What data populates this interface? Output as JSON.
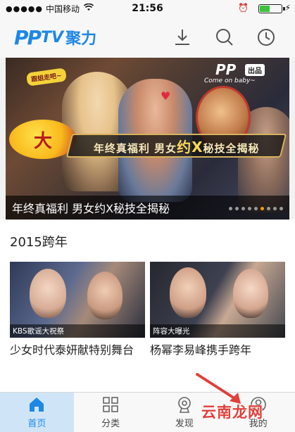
{
  "status_bar": {
    "signal": "●●●●●",
    "carrier": "中国移动",
    "time": "21:56"
  },
  "header": {
    "logo_pp": "PP",
    "logo_tv": "TV",
    "logo_name": "聚力"
  },
  "banner": {
    "caption": "年终真福利 男女约X秘技全揭秘",
    "overlay_text": "年终真福利 男女约X秘技全揭秘",
    "overlay_big": "约X",
    "show_name": "大",
    "bubble": "跟姐走吧~",
    "pp_logo": "PP",
    "pp_sub": "出品",
    "speech": "Come on baby~",
    "dots_total": 9,
    "dots_active_index": 5
  },
  "section": {
    "title": "2015跨年",
    "cards": [
      {
        "label": "KBS歌谣大祝祭",
        "title": "少女时代泰妍献特别舞台"
      },
      {
        "label": "阵容大曝光",
        "title": "杨幂李易峰携手跨年"
      }
    ]
  },
  "tabbar": {
    "tabs": [
      {
        "label": "首页",
        "icon": "home-icon",
        "active": true
      },
      {
        "label": "分类",
        "icon": "grid-icon",
        "active": false
      },
      {
        "label": "发现",
        "icon": "discover-icon",
        "active": false
      },
      {
        "label": "我的",
        "icon": "user-icon",
        "active": false
      }
    ]
  },
  "watermark": "云南龙网",
  "colors": {
    "brand": "#1e88e5",
    "active_tab_bg": "#cfe5f7",
    "dot_active": "#f39c12",
    "annotation_arrow": "#e0403a"
  }
}
